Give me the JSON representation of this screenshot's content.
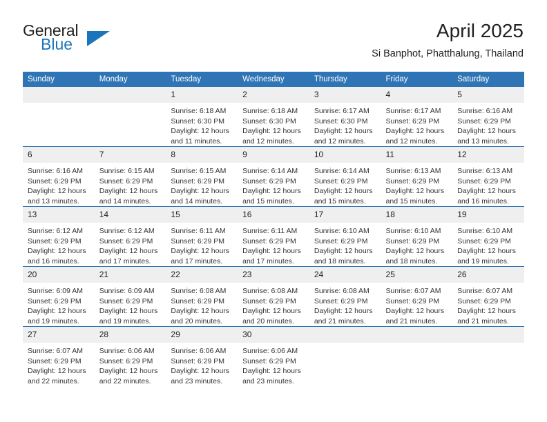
{
  "brand": {
    "name_part1": "General",
    "name_part2": "Blue",
    "flag_icon": "triangle-flag-icon",
    "accent_color": "#1b75bb"
  },
  "header": {
    "title": "April 2025",
    "subtitle": "Si Banphot, Phatthalung, Thailand"
  },
  "theme": {
    "header_row_bg": "#2f75b5",
    "daynum_bg": "#efefef",
    "grid_line": "#2f75b5",
    "text": "#333333"
  },
  "calendar": {
    "weekday_headers": [
      "Sunday",
      "Monday",
      "Tuesday",
      "Wednesday",
      "Thursday",
      "Friday",
      "Saturday"
    ],
    "weeks": [
      [
        {
          "day": "",
          "empty": true,
          "lines": []
        },
        {
          "day": "",
          "empty": true,
          "lines": []
        },
        {
          "day": "1",
          "lines": [
            "Sunrise: 6:18 AM",
            "Sunset: 6:30 PM",
            "Daylight: 12 hours",
            "and 11 minutes."
          ]
        },
        {
          "day": "2",
          "lines": [
            "Sunrise: 6:18 AM",
            "Sunset: 6:30 PM",
            "Daylight: 12 hours",
            "and 12 minutes."
          ]
        },
        {
          "day": "3",
          "lines": [
            "Sunrise: 6:17 AM",
            "Sunset: 6:30 PM",
            "Daylight: 12 hours",
            "and 12 minutes."
          ]
        },
        {
          "day": "4",
          "lines": [
            "Sunrise: 6:17 AM",
            "Sunset: 6:29 PM",
            "Daylight: 12 hours",
            "and 12 minutes."
          ]
        },
        {
          "day": "5",
          "lines": [
            "Sunrise: 6:16 AM",
            "Sunset: 6:29 PM",
            "Daylight: 12 hours",
            "and 13 minutes."
          ]
        }
      ],
      [
        {
          "day": "6",
          "lines": [
            "Sunrise: 6:16 AM",
            "Sunset: 6:29 PM",
            "Daylight: 12 hours",
            "and 13 minutes."
          ]
        },
        {
          "day": "7",
          "lines": [
            "Sunrise: 6:15 AM",
            "Sunset: 6:29 PM",
            "Daylight: 12 hours",
            "and 14 minutes."
          ]
        },
        {
          "day": "8",
          "lines": [
            "Sunrise: 6:15 AM",
            "Sunset: 6:29 PM",
            "Daylight: 12 hours",
            "and 14 minutes."
          ]
        },
        {
          "day": "9",
          "lines": [
            "Sunrise: 6:14 AM",
            "Sunset: 6:29 PM",
            "Daylight: 12 hours",
            "and 15 minutes."
          ]
        },
        {
          "day": "10",
          "lines": [
            "Sunrise: 6:14 AM",
            "Sunset: 6:29 PM",
            "Daylight: 12 hours",
            "and 15 minutes."
          ]
        },
        {
          "day": "11",
          "lines": [
            "Sunrise: 6:13 AM",
            "Sunset: 6:29 PM",
            "Daylight: 12 hours",
            "and 15 minutes."
          ]
        },
        {
          "day": "12",
          "lines": [
            "Sunrise: 6:13 AM",
            "Sunset: 6:29 PM",
            "Daylight: 12 hours",
            "and 16 minutes."
          ]
        }
      ],
      [
        {
          "day": "13",
          "lines": [
            "Sunrise: 6:12 AM",
            "Sunset: 6:29 PM",
            "Daylight: 12 hours",
            "and 16 minutes."
          ]
        },
        {
          "day": "14",
          "lines": [
            "Sunrise: 6:12 AM",
            "Sunset: 6:29 PM",
            "Daylight: 12 hours",
            "and 17 minutes."
          ]
        },
        {
          "day": "15",
          "lines": [
            "Sunrise: 6:11 AM",
            "Sunset: 6:29 PM",
            "Daylight: 12 hours",
            "and 17 minutes."
          ]
        },
        {
          "day": "16",
          "lines": [
            "Sunrise: 6:11 AM",
            "Sunset: 6:29 PM",
            "Daylight: 12 hours",
            "and 17 minutes."
          ]
        },
        {
          "day": "17",
          "lines": [
            "Sunrise: 6:10 AM",
            "Sunset: 6:29 PM",
            "Daylight: 12 hours",
            "and 18 minutes."
          ]
        },
        {
          "day": "18",
          "lines": [
            "Sunrise: 6:10 AM",
            "Sunset: 6:29 PM",
            "Daylight: 12 hours",
            "and 18 minutes."
          ]
        },
        {
          "day": "19",
          "lines": [
            "Sunrise: 6:10 AM",
            "Sunset: 6:29 PM",
            "Daylight: 12 hours",
            "and 19 minutes."
          ]
        }
      ],
      [
        {
          "day": "20",
          "lines": [
            "Sunrise: 6:09 AM",
            "Sunset: 6:29 PM",
            "Daylight: 12 hours",
            "and 19 minutes."
          ]
        },
        {
          "day": "21",
          "lines": [
            "Sunrise: 6:09 AM",
            "Sunset: 6:29 PM",
            "Daylight: 12 hours",
            "and 19 minutes."
          ]
        },
        {
          "day": "22",
          "lines": [
            "Sunrise: 6:08 AM",
            "Sunset: 6:29 PM",
            "Daylight: 12 hours",
            "and 20 minutes."
          ]
        },
        {
          "day": "23",
          "lines": [
            "Sunrise: 6:08 AM",
            "Sunset: 6:29 PM",
            "Daylight: 12 hours",
            "and 20 minutes."
          ]
        },
        {
          "day": "24",
          "lines": [
            "Sunrise: 6:08 AM",
            "Sunset: 6:29 PM",
            "Daylight: 12 hours",
            "and 21 minutes."
          ]
        },
        {
          "day": "25",
          "lines": [
            "Sunrise: 6:07 AM",
            "Sunset: 6:29 PM",
            "Daylight: 12 hours",
            "and 21 minutes."
          ]
        },
        {
          "day": "26",
          "lines": [
            "Sunrise: 6:07 AM",
            "Sunset: 6:29 PM",
            "Daylight: 12 hours",
            "and 21 minutes."
          ]
        }
      ],
      [
        {
          "day": "27",
          "lines": [
            "Sunrise: 6:07 AM",
            "Sunset: 6:29 PM",
            "Daylight: 12 hours",
            "and 22 minutes."
          ]
        },
        {
          "day": "28",
          "lines": [
            "Sunrise: 6:06 AM",
            "Sunset: 6:29 PM",
            "Daylight: 12 hours",
            "and 22 minutes."
          ]
        },
        {
          "day": "29",
          "lines": [
            "Sunrise: 6:06 AM",
            "Sunset: 6:29 PM",
            "Daylight: 12 hours",
            "and 23 minutes."
          ]
        },
        {
          "day": "30",
          "lines": [
            "Sunrise: 6:06 AM",
            "Sunset: 6:29 PM",
            "Daylight: 12 hours",
            "and 23 minutes."
          ]
        },
        {
          "day": "",
          "empty": true,
          "lines": []
        },
        {
          "day": "",
          "empty": true,
          "lines": []
        },
        {
          "day": "",
          "empty": true,
          "lines": []
        }
      ]
    ]
  }
}
